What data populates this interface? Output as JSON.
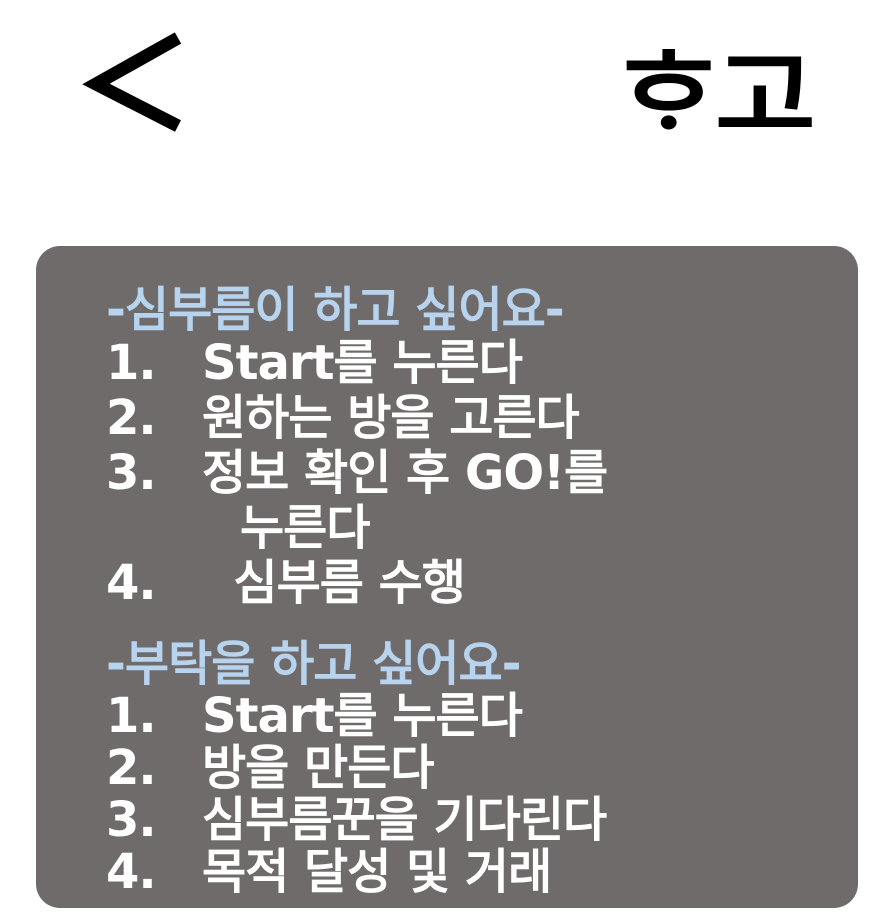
{
  "header": {
    "back_icon": "chevron-left-icon",
    "title": "ᄒᆞ고"
  },
  "guide": {
    "errand_section": {
      "title": "-심부름이 하고 싶어요-",
      "steps": [
        {
          "num": "1.",
          "text": "Start를 누른다"
        },
        {
          "num": "2.",
          "text": "원하는 방을 고른다"
        },
        {
          "num": "3.",
          "text": "정보 확인 후 GO!를"
        },
        {
          "num": "",
          "text": "누른다"
        },
        {
          "num": "4.",
          "text": "  심부름 수행"
        }
      ]
    },
    "request_section": {
      "title": "-부탁을 하고 싶어요-",
      "steps": [
        {
          "num": "1.",
          "text": "Start를 누른다"
        },
        {
          "num": "2.",
          "text": "방을 만든다"
        },
        {
          "num": "3.",
          "text": "심부름꾼을 기다린다"
        },
        {
          "num": "4.",
          "text": "목적 달성 및 거래"
        }
      ]
    }
  },
  "colors": {
    "card_background": "#6f6b6b",
    "section_title": "#b7d3ee",
    "step_text": "#ffffff"
  }
}
